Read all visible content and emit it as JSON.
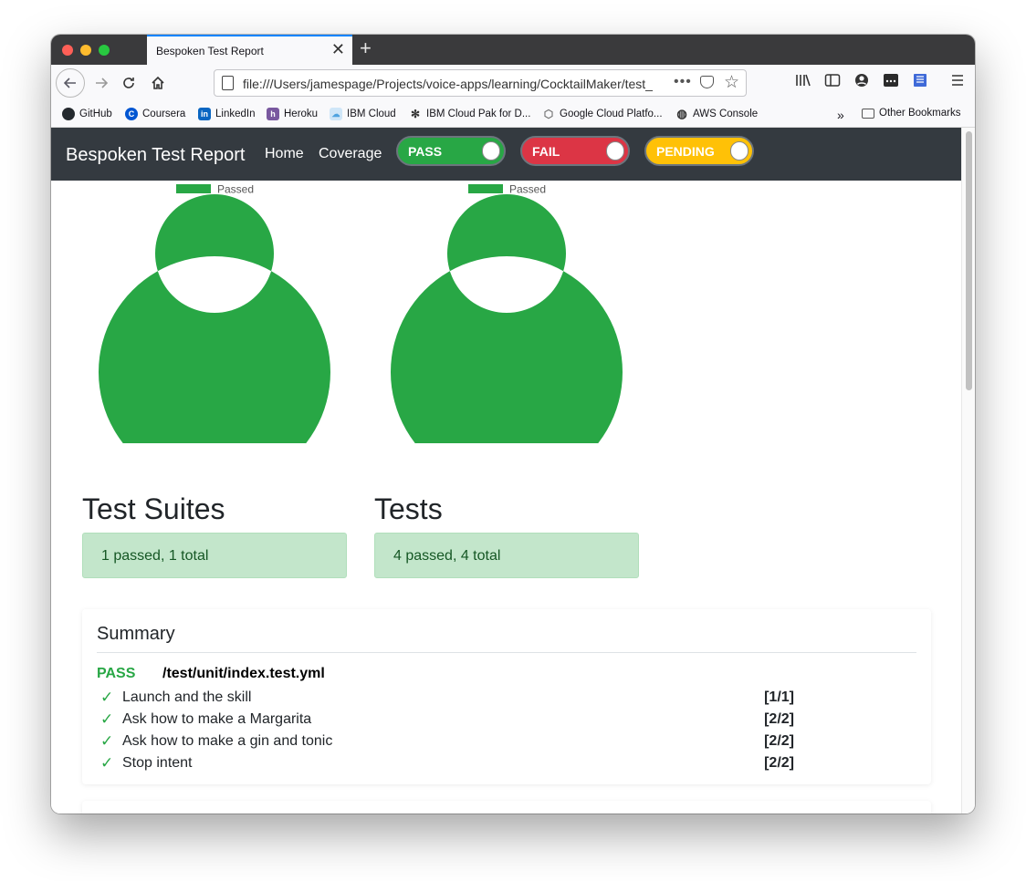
{
  "browser": {
    "tab_title": "Bespoken Test Report",
    "tab_close": "✕",
    "new_tab": "+",
    "url": "file:///Users/jamespage/Projects/voice-apps/learning/CocktailMaker/test_",
    "url_more": "•••"
  },
  "bookmarks": [
    {
      "label": "GitHub",
      "icon": "github-icon",
      "color": "#24292e"
    },
    {
      "label": "Coursera",
      "icon": "coursera-icon",
      "color": "#0056d2"
    },
    {
      "label": "LinkedIn",
      "icon": "linkedin-icon",
      "color": "#0a66c2"
    },
    {
      "label": "Heroku",
      "icon": "heroku-icon",
      "color": "#79589f"
    },
    {
      "label": "IBM Cloud",
      "icon": "cloud-icon",
      "color": "#4fa3e0"
    },
    {
      "label": "IBM Cloud Pak for D...",
      "icon": "gear-icon",
      "color": "#333333"
    },
    {
      "label": "Google Cloud Platfo...",
      "icon": "gcp-icon",
      "color": "#777777"
    },
    {
      "label": "AWS Console",
      "icon": "globe-icon",
      "color": "#333333"
    }
  ],
  "other_bookmarks": "Other Bookmarks",
  "navbar": {
    "brand": "Bespoken Test Report",
    "home": "Home",
    "coverage": "Coverage",
    "pass": "PASS",
    "fail": "FAIL",
    "pending": "PENDING"
  },
  "colors": {
    "pass": "#28a745",
    "fail": "#dc3545",
    "pending": "#ffc107",
    "navbar": "#343a40"
  },
  "chart_data": [
    {
      "type": "pie",
      "legend": [
        "Passed"
      ],
      "legend_position": "top",
      "series": [
        {
          "name": "Passed",
          "values": [
            1
          ]
        }
      ],
      "categories": [
        "Passed"
      ]
    },
    {
      "type": "pie",
      "legend": [
        "Passed"
      ],
      "legend_position": "top",
      "series": [
        {
          "name": "Passed",
          "values": [
            4
          ]
        }
      ],
      "categories": [
        "Passed"
      ]
    }
  ],
  "suites": {
    "title": "Test Suites",
    "summary": "1 passed, 1 total"
  },
  "tests": {
    "title": "Tests",
    "summary": "4 passed, 4 total"
  },
  "summary": {
    "title": "Summary",
    "suite_status": "PASS",
    "suite_path": "/test/unit/index.test.yml",
    "rows": [
      {
        "check": "✓",
        "name": "Launch and the skill",
        "count": "[1/1]"
      },
      {
        "check": "✓",
        "name": "Ask how to make a Margarita",
        "count": "[2/2]"
      },
      {
        "check": "✓",
        "name": "Ask how to make a gin and tonic",
        "count": "[2/2]"
      },
      {
        "check": "✓",
        "name": "Stop intent",
        "count": "[2/2]"
      }
    ]
  }
}
